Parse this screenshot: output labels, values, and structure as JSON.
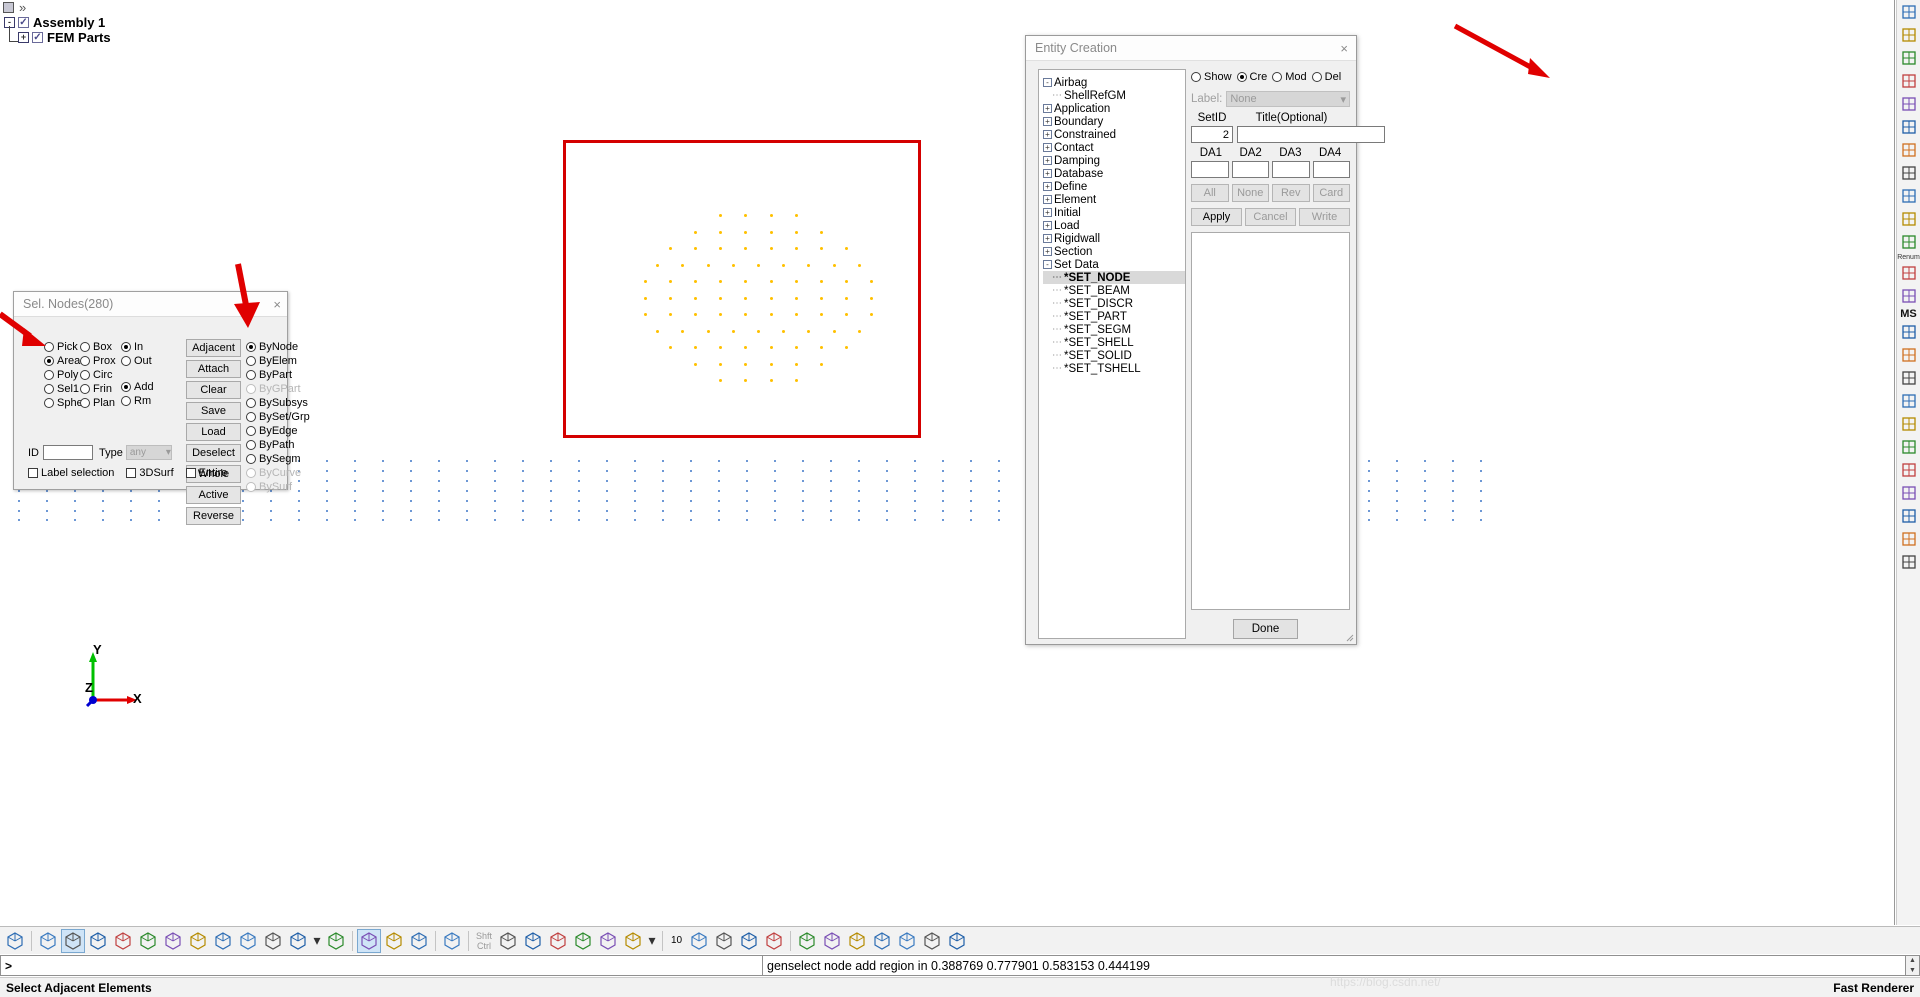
{
  "app": {
    "status_left": "Select Adjacent Elements",
    "status_right": "Fast Renderer",
    "watermark": "https://blog.csdn.net/"
  },
  "model_tree": {
    "toolbar_icons": [
      "square-icon",
      "chevron-double-right-icon"
    ],
    "items": [
      {
        "label": "Assembly 1",
        "expander": "-",
        "checked": true
      },
      {
        "label": "FEM Parts",
        "expander": "+",
        "checked": true
      }
    ]
  },
  "sel_nodes_dialog": {
    "title": "Sel. Nodes(280)",
    "close": "×",
    "mode_col_a": [
      {
        "label": "Pick",
        "selected": false
      },
      {
        "label": "Area",
        "selected": true
      },
      {
        "label": "Poly",
        "selected": false
      },
      {
        "label": "Sel1",
        "selected": false
      },
      {
        "label": "Sphe",
        "selected": false
      }
    ],
    "mode_col_b": [
      {
        "label": "Box",
        "selected": false
      },
      {
        "label": "Prox",
        "selected": false
      },
      {
        "label": "Circ",
        "selected": false
      },
      {
        "label": "Frin",
        "selected": false
      },
      {
        "label": "Plan",
        "selected": false
      }
    ],
    "inout": [
      {
        "label": "In",
        "selected": true
      },
      {
        "label": "Out",
        "selected": false
      }
    ],
    "addrm": [
      {
        "label": "Add",
        "selected": true
      },
      {
        "label": "Rm",
        "selected": false
      }
    ],
    "buttons": [
      "Adjacent",
      "Attach",
      "Clear",
      "Save",
      "Load",
      "Deselect",
      "Whole",
      "Active",
      "Reverse"
    ],
    "by_options": [
      {
        "label": "ByNode",
        "selected": true,
        "disabled": false
      },
      {
        "label": "ByElem",
        "selected": false,
        "disabled": false
      },
      {
        "label": "ByPart",
        "selected": false,
        "disabled": false
      },
      {
        "label": "ByGPart",
        "selected": false,
        "disabled": true
      },
      {
        "label": "BySubsys",
        "selected": false,
        "disabled": false
      },
      {
        "label": "BySet/Grp",
        "selected": false,
        "disabled": false
      },
      {
        "label": "ByEdge",
        "selected": false,
        "disabled": false
      },
      {
        "label": "ByPath",
        "selected": false,
        "disabled": false
      },
      {
        "label": "BySegm",
        "selected": false,
        "disabled": false
      },
      {
        "label": "ByCurve",
        "selected": false,
        "disabled": true
      },
      {
        "label": "BySurf",
        "selected": false,
        "disabled": true
      }
    ],
    "id_label": "ID",
    "id_value": "",
    "type_label": "Type",
    "type_value": "any",
    "checkboxes": [
      {
        "label": "Label selection",
        "checked": false
      },
      {
        "label": "3DSurf",
        "checked": false
      },
      {
        "label": "Entire",
        "checked": false
      }
    ]
  },
  "entity_creation": {
    "title": "Entity Creation",
    "close": "×",
    "tree": [
      {
        "label": "Airbag",
        "expander": "-",
        "indent": 0
      },
      {
        "label": "ShellRefGM",
        "expander": "",
        "indent": 1
      },
      {
        "label": "Application",
        "expander": "+",
        "indent": 0
      },
      {
        "label": "Boundary",
        "expander": "+",
        "indent": 0
      },
      {
        "label": "Constrained",
        "expander": "+",
        "indent": 0
      },
      {
        "label": "Contact",
        "expander": "+",
        "indent": 0
      },
      {
        "label": "Damping",
        "expander": "+",
        "indent": 0
      },
      {
        "label": "Database",
        "expander": "+",
        "indent": 0
      },
      {
        "label": "Define",
        "expander": "+",
        "indent": 0
      },
      {
        "label": "Element",
        "expander": "+",
        "indent": 0
      },
      {
        "label": "Initial",
        "expander": "+",
        "indent": 0
      },
      {
        "label": "Load",
        "expander": "+",
        "indent": 0
      },
      {
        "label": "Rigidwall",
        "expander": "+",
        "indent": 0
      },
      {
        "label": "Section",
        "expander": "+",
        "indent": 0
      },
      {
        "label": "Set Data",
        "expander": "-",
        "indent": 0
      },
      {
        "label": "*SET_NODE",
        "expander": "",
        "indent": 1,
        "selected": true
      },
      {
        "label": "*SET_BEAM",
        "expander": "",
        "indent": 1
      },
      {
        "label": "*SET_DISCR",
        "expander": "",
        "indent": 1
      },
      {
        "label": "*SET_PART",
        "expander": "",
        "indent": 1
      },
      {
        "label": "*SET_SEGM",
        "expander": "",
        "indent": 1
      },
      {
        "label": "*SET_SHELL",
        "expander": "",
        "indent": 1
      },
      {
        "label": "*SET_SOLID",
        "expander": "",
        "indent": 1
      },
      {
        "label": "*SET_TSHELL",
        "expander": "",
        "indent": 1
      }
    ],
    "modes": [
      {
        "label": "Show",
        "selected": false
      },
      {
        "label": "Cre",
        "selected": true
      },
      {
        "label": "Mod",
        "selected": false
      },
      {
        "label": "Del",
        "selected": false
      }
    ],
    "label_caption": "Label:",
    "label_value": "None",
    "setid_header": "SetID",
    "setid_value": "2",
    "title_header": "Title(Optional)",
    "title_value": "",
    "da_headers": [
      "DA1",
      "DA2",
      "DA3",
      "DA4"
    ],
    "da_values": [
      "",
      "",
      "",
      ""
    ],
    "row_buttons": [
      {
        "label": "All",
        "enabled": false
      },
      {
        "label": "None",
        "enabled": false
      },
      {
        "label": "Rev",
        "enabled": false
      },
      {
        "label": "Card",
        "enabled": false
      }
    ],
    "action_buttons": [
      {
        "label": "Apply",
        "enabled": true
      },
      {
        "label": "Cancel",
        "enabled": false
      },
      {
        "label": "Write",
        "enabled": false
      }
    ],
    "done_button": "Done"
  },
  "command_bar": {
    "prompt": ">",
    "echo": "genselect node add region in 0.388769 0.777901 0.583153 0.444199"
  },
  "viewport": {
    "axis_x": "X",
    "axis_y": "Y",
    "axis_z": "Z",
    "side_tab": "‹"
  },
  "bottom_toolbar": {
    "numeric_label": "10",
    "modifier_lines": [
      "Shft",
      "Ctrl"
    ],
    "icons": [
      "fringe-icon",
      "mesh-wire-icon",
      "shade-icon",
      "shade-grey-icon",
      "mesh-dense-icon",
      "hidden-line-icon",
      "feature-line-icon",
      "dotted-icon",
      "mesh-shade-icon",
      "mesh-solid-icon",
      "mesh-edge-icon",
      "contour-icon",
      "dropdown-icon",
      "units-icon",
      "view-solid-icon",
      "view-blue-icon",
      "wireframe-box-icon",
      "pointer-icon",
      "move-icon",
      "zoom-icon",
      "rotate-icon",
      "zoom-center-icon",
      "globe-icon",
      "box-icon",
      "dropdown2-icon",
      "axis-icon",
      "part-blue-icon",
      "home-icon",
      "lightning-icon",
      "chart-icon",
      "note-icon",
      "grid-icon",
      "sphere-green-icon",
      "render1-icon",
      "render2-icon",
      "plot-icon"
    ]
  },
  "right_toolbar": {
    "icons": [
      "element-tools-icon",
      "curve-icon",
      "model-icon",
      "mesh-gen-icon",
      "surface-icon",
      "geometry-icon",
      "sphere-icon",
      "settings-icon",
      "shell-icon",
      "solid-icon",
      "renum-icon",
      "table-icon",
      "ms-icon",
      "globe2-icon",
      "rect-icon",
      "color-icon",
      "palette-icon",
      "hist-icon",
      "page-icon",
      "blast-icon",
      "tree2-icon",
      "measure-icon",
      "graph-icon",
      "cross-icon"
    ],
    "renum_label": "Renum",
    "ms_label": "MS"
  },
  "chart_data": {
    "type": "scatter",
    "title": "",
    "note": "FE mesh node cloud in 3D viewport",
    "selected_nodes_rows": [
      4,
      6,
      8,
      9,
      10,
      10,
      10,
      9,
      8,
      6,
      4
    ],
    "legend": []
  }
}
